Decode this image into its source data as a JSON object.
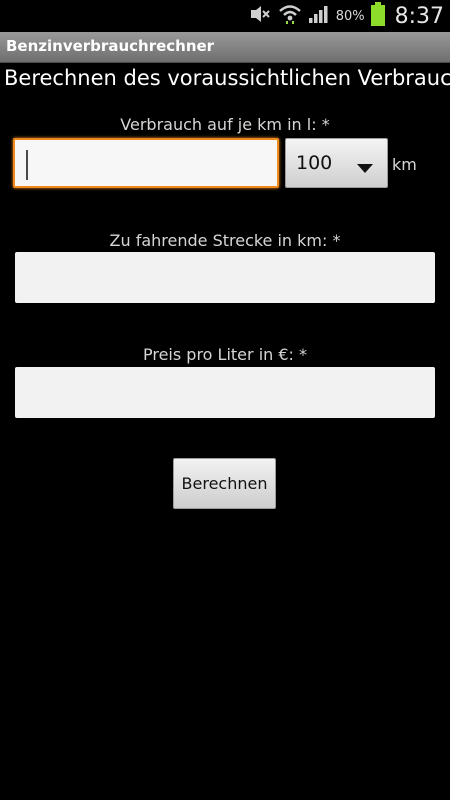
{
  "statusbar": {
    "battery_percent": "80%",
    "clock": "8:37",
    "icons": [
      "mute-icon",
      "wifi-icon",
      "signal-icon",
      "battery-icon"
    ]
  },
  "app": {
    "title": "Benzinverbrauchrechner"
  },
  "heading": "Berechnen des voraussichtlichen Verbrauch",
  "form": {
    "consumption": {
      "label": "Verbrauch auf je km in l: *",
      "value": "",
      "distance_select_value": "100",
      "unit": "km"
    },
    "distance": {
      "label": "Zu fahrende Strecke in km: *",
      "value": ""
    },
    "price": {
      "label": "Preis pro Liter in €: *",
      "value": ""
    },
    "submit_label": "Berechnen"
  },
  "colors": {
    "background": "#000000",
    "titlebar": "#8a8a8a",
    "focus_accent": "#f08a1c",
    "input_bg": "#f2f2f2",
    "battery": "#8ddc2c"
  }
}
